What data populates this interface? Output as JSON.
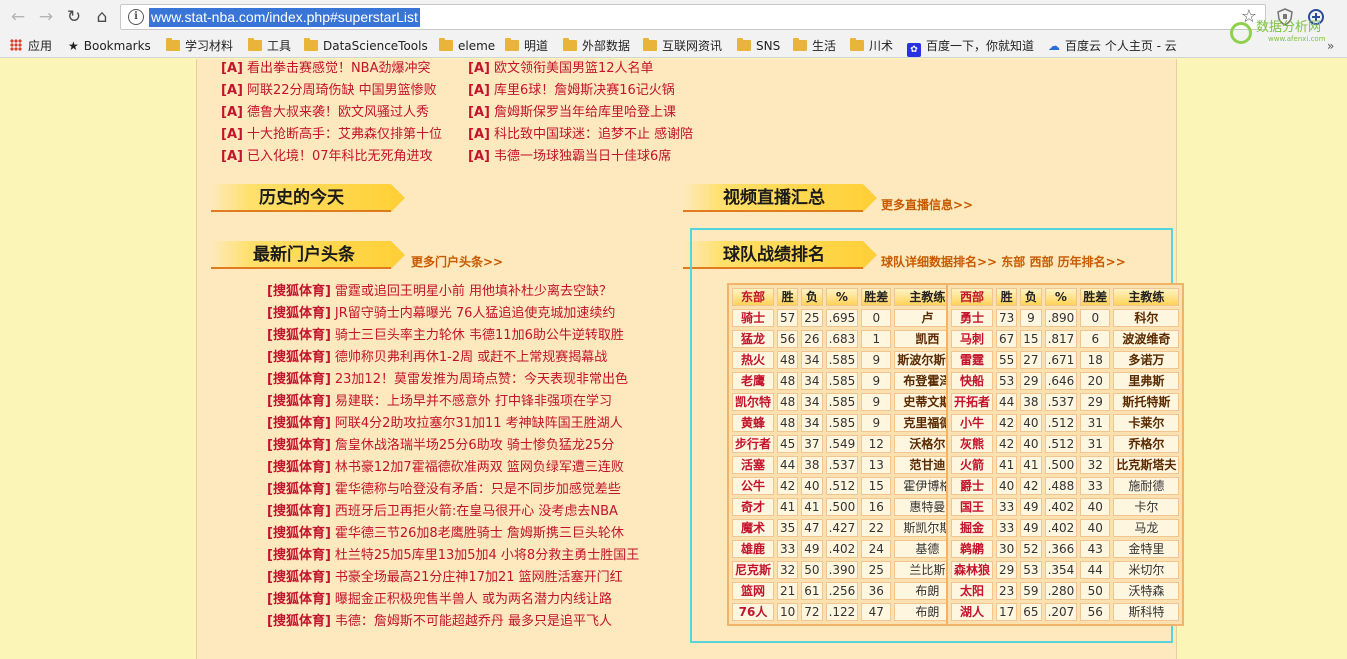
{
  "browser": {
    "url": "www.stat-nba.com/index.php#superstarList",
    "bookmarks": [
      "应用",
      "Bookmarks",
      "学习材料",
      "工具",
      "DataScienceTools",
      "eleme",
      "明道",
      "外部数据",
      "互联网资讯",
      "SNS",
      "生活",
      "川术",
      "百度一下，你就知道",
      "百度云 个人主页 - 云"
    ],
    "watermark": {
      "main": "数据分析网",
      "sub": "www.afenxi.com"
    }
  },
  "top_news": {
    "tag": "[A]",
    "left": [
      "看出拳击赛感觉！NBA劲爆冲突",
      "阿联22分周琦伤缺 中国男篮惨败",
      "德鲁大叔来袭！欧文风骚过人秀",
      "十大抢断高手：艾弗森仅排第十位",
      "已入化境！07年科比无死角进攻"
    ],
    "right": [
      "欧文领衔美国男篮12人名单",
      "库里6球！詹姆斯决赛16记火锅",
      "詹姆斯保罗当年给库里哈登上课",
      "科比致中国球迷：追梦不止 感谢陪",
      "韦德一场球独霸当日十佳球6席"
    ]
  },
  "sections": {
    "history": {
      "title": "历史的今天"
    },
    "video": {
      "title": "视频直播汇总",
      "more": "更多直播信息>>"
    },
    "portal": {
      "title": "最新门户头条",
      "more": "更多门户头条>>"
    },
    "standings": {
      "title": "球队战绩排名",
      "more": "球队详细数据排名>> 东部 西部 历年排名>>"
    }
  },
  "portal_news": {
    "tag": "[搜狐体育]",
    "items": [
      "雷霆或追回王明星小前 用他填补杜少离去空缺？",
      "JR留守骑士内幕曝光 76人猛追追使克城加速续约",
      "骑士三巨头率主力轮休 韦德11加6助公牛逆转取胜",
      "德帅称贝弗利再休1-2周 或赶不上常规赛揭幕战",
      "23加12！莫雷发推为周琦点赞：今天表现非常出色",
      "易建联：上场早并不感意外 打中锋非强项在学习",
      "阿联4分2助攻拉塞尔31加11 考神缺阵国王胜湖人",
      "詹皇休战洛瑞半场25分6助攻 骑士惨负猛龙25分",
      "林书豪12加7霍福德砍准两双 篮网负绿军遭三连败",
      "霍华德称与哈登没有矛盾：只是不同步加感觉差些",
      "西班牙后卫再拒火箭:在皇马很开心 没考虑去NBA",
      "霍华德三节26加8老鹰胜骑士 詹姆斯携三巨头轮休",
      "杜兰特25加5库里13加5加4 小将8分救主勇士胜国王",
      "书豪全场最高21分庄神17加21 篮网胜活塞开门红",
      "曝掘金正积极兜售半兽人 或为两名潜力内线让路",
      "韦德：詹姆斯不可能超越乔丹 最多只是追平飞人"
    ]
  },
  "standings": {
    "headers": [
      "胜",
      "负",
      "%",
      "胜差",
      "主教练"
    ],
    "east": {
      "label": "东部",
      "rows": [
        [
          "骑士",
          "57",
          "25",
          ".695",
          "0",
          "卢"
        ],
        [
          "猛龙",
          "56",
          "26",
          ".683",
          "1",
          "凯西"
        ],
        [
          "热火",
          "48",
          "34",
          ".585",
          "9",
          "斯波尔斯特"
        ],
        [
          "老鹰",
          "48",
          "34",
          ".585",
          "9",
          "布登霍泽"
        ],
        [
          "凯尔特",
          "48",
          "34",
          ".585",
          "9",
          "史蒂文斯"
        ],
        [
          "黄蜂",
          "48",
          "34",
          ".585",
          "9",
          "克里福德"
        ],
        [
          "步行者",
          "45",
          "37",
          ".549",
          "12",
          "沃格尔"
        ],
        [
          "活塞",
          "44",
          "38",
          ".537",
          "13",
          "范甘迪"
        ],
        [
          "公牛",
          "42",
          "40",
          ".512",
          "15",
          "霍伊博格"
        ],
        [
          "奇才",
          "41",
          "41",
          ".500",
          "16",
          "惠特曼"
        ],
        [
          "魔术",
          "35",
          "47",
          ".427",
          "22",
          "斯凯尔斯"
        ],
        [
          "雄鹿",
          "33",
          "49",
          ".402",
          "24",
          "基德"
        ],
        [
          "尼克斯",
          "32",
          "50",
          ".390",
          "25",
          "兰比斯"
        ],
        [
          "篮网",
          "21",
          "61",
          ".256",
          "36",
          "布朗"
        ],
        [
          "76人",
          "10",
          "72",
          ".122",
          "47",
          "布朗"
        ]
      ]
    },
    "west": {
      "label": "西部",
      "rows": [
        [
          "勇士",
          "73",
          "9",
          ".890",
          "0",
          "科尔"
        ],
        [
          "马刺",
          "67",
          "15",
          ".817",
          "6",
          "波波维奇"
        ],
        [
          "雷霆",
          "55",
          "27",
          ".671",
          "18",
          "多诺万"
        ],
        [
          "快船",
          "53",
          "29",
          ".646",
          "20",
          "里弗斯"
        ],
        [
          "开拓者",
          "44",
          "38",
          ".537",
          "29",
          "斯托特斯"
        ],
        [
          "小牛",
          "42",
          "40",
          ".512",
          "31",
          "卡莱尔"
        ],
        [
          "灰熊",
          "42",
          "40",
          ".512",
          "31",
          "乔格尔"
        ],
        [
          "火箭",
          "41",
          "41",
          ".500",
          "32",
          "比克斯塔夫"
        ],
        [
          "爵士",
          "40",
          "42",
          ".488",
          "33",
          "施耐德"
        ],
        [
          "国王",
          "33",
          "49",
          ".402",
          "40",
          "卡尔"
        ],
        [
          "掘金",
          "33",
          "49",
          ".402",
          "40",
          "马龙"
        ],
        [
          "鹈鹕",
          "30",
          "52",
          ".366",
          "43",
          "金特里"
        ],
        [
          "森林狼",
          "29",
          "53",
          ".354",
          "44",
          "米切尔"
        ],
        [
          "太阳",
          "23",
          "59",
          ".280",
          "50",
          "沃特森"
        ],
        [
          "湖人",
          "17",
          "65",
          ".207",
          "56",
          "斯科特"
        ]
      ]
    }
  }
}
